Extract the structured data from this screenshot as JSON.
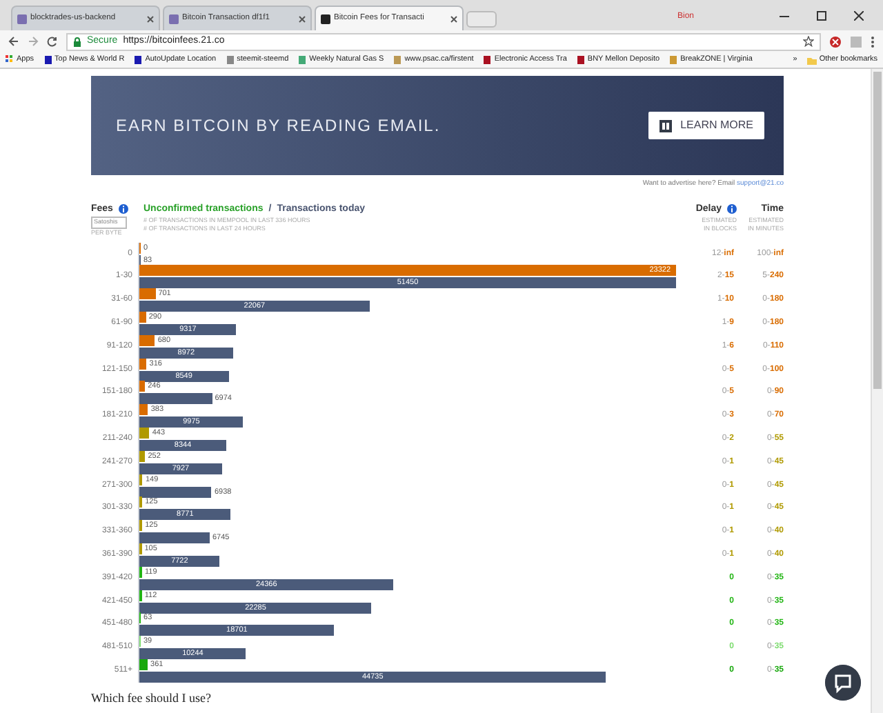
{
  "browser": {
    "tabs": [
      {
        "title": "blocktrades-us-backend",
        "selected": false
      },
      {
        "title": "Bitcoin Transaction df1f1",
        "selected": false
      },
      {
        "title": "Bitcoin Fees for Transacti",
        "selected": true
      }
    ],
    "profile": "Bion",
    "secure_label": "Secure",
    "url": "https://bitcoinfees.21.co",
    "bookmarks": [
      "Apps",
      "Top News & World R",
      "AutoUpdate Location",
      "steemit-steemd",
      "Weekly Natural Gas S",
      "www.psac.ca/firstent",
      "Electronic Access Tra",
      "BNY Mellon Deposito",
      "BreakZONE | Virginia"
    ],
    "bookmarks_more": "»",
    "other_bookmarks": "Other bookmarks"
  },
  "banner": {
    "headline": "EARN BITCOIN BY READING EMAIL.",
    "button": "LEARN MORE"
  },
  "advertise": {
    "text": "Want to advertise here? Email ",
    "link": "support@21.co"
  },
  "header": {
    "fees": "Fees",
    "unit": "Satoshis",
    "per": "PER BYTE",
    "unconfirmed": "Unconfirmed transactions",
    "separator": "/",
    "today": "Transactions today",
    "unconfirmed_note": "# OF TRANSACTIONS IN MEMPOOL IN LAST 336 HOURS",
    "today_note": "# OF TRANSACTIONS IN LAST 24 HOURS",
    "delay": "Delay",
    "delay_note_1": "ESTIMATED",
    "delay_note_2": "IN BLOCKS",
    "time": "Time",
    "time_note_1": "ESTIMATED",
    "time_note_2": "IN MINUTES"
  },
  "rows": [
    {
      "fee": "0",
      "unconfirmed": "0",
      "today": "83",
      "delay": "12-inf",
      "time": "100-inf",
      "color": "#d96c00"
    },
    {
      "fee": "1-30",
      "unconfirmed": "23322",
      "today": "51450",
      "delay": "2-15",
      "time": "5-240",
      "color": "#d96c00"
    },
    {
      "fee": "31-60",
      "unconfirmed": "701",
      "today": "22067",
      "delay": "1-10",
      "time": "0-180",
      "color": "#d96c00"
    },
    {
      "fee": "61-90",
      "unconfirmed": "290",
      "today": "9317",
      "delay": "1-9",
      "time": "0-180",
      "color": "#d96c00"
    },
    {
      "fee": "91-120",
      "unconfirmed": "680",
      "today": "8972",
      "delay": "1-6",
      "time": "0-110",
      "color": "#d96c00"
    },
    {
      "fee": "121-150",
      "unconfirmed": "316",
      "today": "8549",
      "delay": "0-5",
      "time": "0-100",
      "color": "#d96c00"
    },
    {
      "fee": "151-180",
      "unconfirmed": "246",
      "today": "6974",
      "delay": "0-5",
      "time": "0-90",
      "color": "#d96c00"
    },
    {
      "fee": "181-210",
      "unconfirmed": "383",
      "today": "9975",
      "delay": "0-3",
      "time": "0-70",
      "color": "#d96c00"
    },
    {
      "fee": "211-240",
      "unconfirmed": "443",
      "today": "8344",
      "delay": "0-2",
      "time": "0-55",
      "color": "#b09a00"
    },
    {
      "fee": "241-270",
      "unconfirmed": "252",
      "today": "7927",
      "delay": "0-1",
      "time": "0-45",
      "color": "#b09a00"
    },
    {
      "fee": "271-300",
      "unconfirmed": "149",
      "today": "6938",
      "delay": "0-1",
      "time": "0-45",
      "color": "#b09a00"
    },
    {
      "fee": "301-330",
      "unconfirmed": "125",
      "today": "8771",
      "delay": "0-1",
      "time": "0-45",
      "color": "#b09a00"
    },
    {
      "fee": "331-360",
      "unconfirmed": "125",
      "today": "6745",
      "delay": "0-1",
      "time": "0-40",
      "color": "#b09a00"
    },
    {
      "fee": "361-390",
      "unconfirmed": "105",
      "today": "7722",
      "delay": "0-1",
      "time": "0-40",
      "color": "#b09a00"
    },
    {
      "fee": "391-420",
      "unconfirmed": "119",
      "today": "24366",
      "delay": "0",
      "time": "0-35",
      "color": "#22b514"
    },
    {
      "fee": "421-450",
      "unconfirmed": "112",
      "today": "22285",
      "delay": "0",
      "time": "0-35",
      "color": "#22b514"
    },
    {
      "fee": "451-480",
      "unconfirmed": "63",
      "today": "18701",
      "delay": "0",
      "time": "0-35",
      "color": "#22b514"
    },
    {
      "fee": "481-510",
      "unconfirmed": "39",
      "today": "10244",
      "delay": "0",
      "time": "0-35",
      "color": "#7edc70"
    },
    {
      "fee": "511+",
      "unconfirmed": "361",
      "today": "44735",
      "delay": "0",
      "time": "0-35",
      "color": "#18a80c"
    }
  ],
  "question": "Which fee should I use?"
}
